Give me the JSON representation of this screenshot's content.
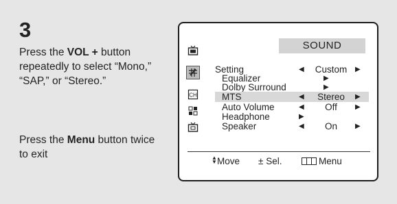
{
  "step": {
    "number": "3"
  },
  "instructions": {
    "p1_pre": "Press the ",
    "p1_bold": "VOL +",
    "p1_post": " button repeatedly to select “Mono,” “SAP,” or “Stereo.”",
    "p2_pre": "Press the ",
    "p2_bold": "Menu",
    "p2_post": " button twice to exit"
  },
  "panel": {
    "title": "SOUND",
    "icons": [
      "tv-picture-icon",
      "sound-icon",
      "channel-icon",
      "function-icon",
      "setup-icon"
    ],
    "active_icon_index": 1,
    "rows": [
      {
        "label": "Setting",
        "value": "Custom",
        "left_arrow": "◀",
        "right_arrow": "▶",
        "indent": false
      },
      {
        "label": "Equalizer",
        "value": "",
        "mid_arrow": "▶",
        "indent": true
      },
      {
        "label": "Dolby Surround",
        "value": "",
        "mid_arrow": "▶",
        "indent": true
      },
      {
        "label": "MTS",
        "value": "Stereo",
        "left_arrow": "◀",
        "right_arrow": "▶",
        "indent": false,
        "highlight": true
      },
      {
        "label": "Auto Volume",
        "value": "Off",
        "left_arrow": "◀",
        "right_arrow": "▶",
        "indent": true
      },
      {
        "label": "Headphone",
        "value": "",
        "left_arrow": "▶",
        "indent": true
      },
      {
        "label": "Speaker",
        "value": "On",
        "left_arrow": "◀",
        "right_arrow": "▶",
        "indent": true
      }
    ],
    "footer": {
      "move": "Move",
      "move_glyph": "▲▼",
      "sel": "Sel.",
      "sel_glyph": "±",
      "menu": "Menu"
    }
  }
}
